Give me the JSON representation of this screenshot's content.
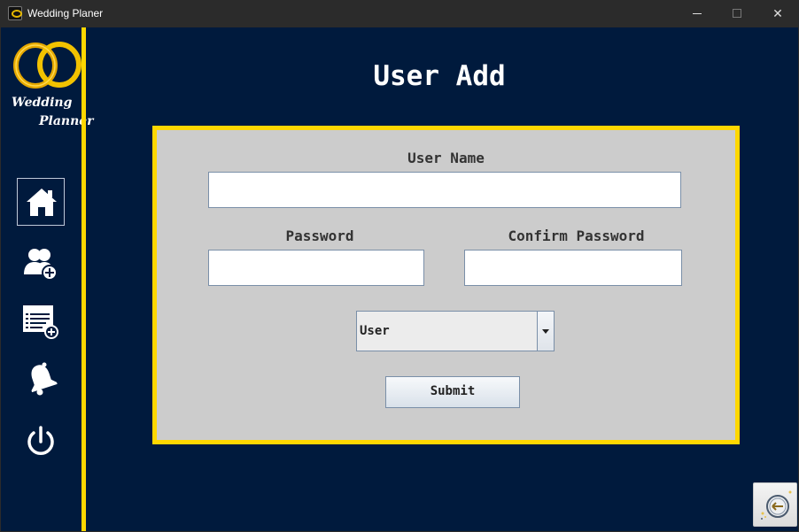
{
  "window": {
    "title": "Wedding Planer",
    "controls": {
      "minimize": "",
      "maximize": "",
      "close": "✕"
    }
  },
  "sidebar": {
    "logo_line1": "Wedding",
    "logo_line2": "Planner",
    "items": [
      {
        "name": "home",
        "icon": "home-icon",
        "active": true
      },
      {
        "name": "add-user",
        "icon": "add-user-icon",
        "active": false
      },
      {
        "name": "add-list",
        "icon": "add-list-icon",
        "active": false
      },
      {
        "name": "bell",
        "icon": "bell-icon",
        "active": false
      },
      {
        "name": "power",
        "icon": "power-icon",
        "active": false
      }
    ]
  },
  "main": {
    "title": "User Add",
    "form": {
      "username_label": "User Name",
      "username_value": "",
      "password_label": "Password",
      "password_value": "",
      "confirm_label": "Confirm Password",
      "confirm_value": "",
      "role_value": "User",
      "submit_label": "Submit"
    }
  },
  "colors": {
    "background": "#001a3d",
    "accent": "#ffd700",
    "panel": "#cccccc"
  }
}
